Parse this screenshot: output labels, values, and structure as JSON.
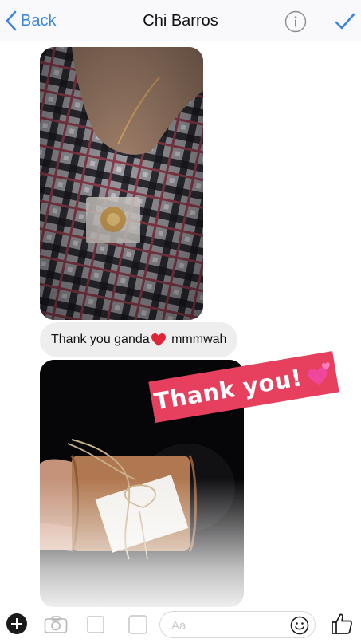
{
  "header": {
    "back_label": "Back",
    "contact_name": "Chi Barros",
    "info_icon": "info-icon",
    "done_icon": "checkmark-icon"
  },
  "messages": {
    "photo_1_description_icon": "photo-message",
    "text_bubble": {
      "before": "Thank you ganda",
      "emoji": "red-heart",
      "after": " mmmwah"
    },
    "sticker": {
      "text": "Thank you!",
      "emoji": "two-hearts",
      "color": "#e7405e"
    }
  },
  "toolbar": {
    "composer_placeholder": "Aa",
    "icons": [
      "plus-icon",
      "camera-icon",
      "gallery-icon",
      "mic-icon",
      "emoji-icon",
      "thumbs-up-icon"
    ]
  },
  "colors": {
    "accent": "#3b85e0",
    "bubble": "#eeeeef"
  }
}
